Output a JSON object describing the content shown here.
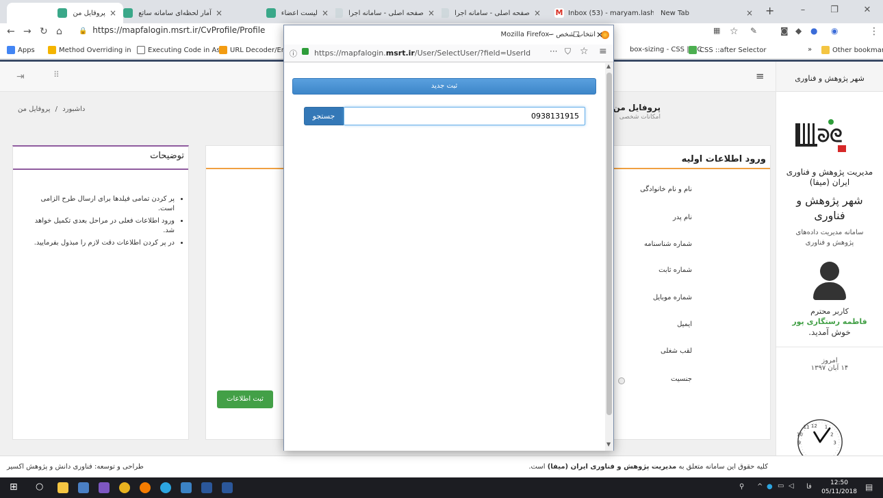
{
  "browser": {
    "tabs": [
      {
        "title": "پروفایل من",
        "active": true
      },
      {
        "title": "آمار لحظه‌ای سامانه ساتع"
      },
      {
        "title": "لیست اعضاء"
      },
      {
        "title": "صفحه اصلی - سامانه اجرا"
      },
      {
        "title": "صفحه اصلی - سامانه اجرا"
      },
      {
        "title": "Inbox (53) - maryam.lash"
      },
      {
        "title": "New Tab"
      }
    ],
    "url": "https://mapfalogin.msrt.ir/CvProfile/Profile",
    "bookmarks": [
      "Apps",
      "Method Overriding in",
      "Executing Code in As",
      "URL Decoder/Enc",
      "box-sizing - CSS | MC",
      "CSS ::after Selector",
      "»",
      "Other bookmarks"
    ]
  },
  "sidebar": {
    "header": "شهر پژوهش و فناوری",
    "org_name": "مدیریت پژوهش و فناوری ایران (میفا)",
    "city": "شهر پژوهش و فناوری",
    "system_desc": "سامانه مدیریت داده‌های پژوهش و فناوری",
    "greeting": "کاربر محترم",
    "user_name": "فاطمه رستگاری پور",
    "welcome": "خوش آمدید.",
    "today_label": "امروز",
    "today_date": "۱۴ آبان ۱۳۹۷"
  },
  "page": {
    "title": "پروفایل من",
    "subtitle": "امکانات شخصی",
    "breadcrumb_home": "داشبورد",
    "breadcrumb_sep": "/",
    "breadcrumb_current": "پروفایل من"
  },
  "form": {
    "title": "ورود اطلاعات اولیه",
    "fields": [
      "نام و نام خانوادگی",
      "نام پدر",
      "شماره شناسنامه",
      "شماره ثابت",
      "شماره موبایل",
      "ایمیل",
      "لقب شغلی",
      "جنسیت"
    ],
    "submit": "ثبت اطلاعات"
  },
  "notes": {
    "title": "توضیحات",
    "items": [
      "پر کردن تمامی فیلدها برای ارسال طرح الزامی است.",
      "ورود اطلاعات فعلی در مراحل بعدی تکمیل خواهد شد.",
      "در پر کردن اطلاعات دقت لازم را مبذول بفرمایید."
    ]
  },
  "footer": {
    "left": "طراحی و توسعه: فناوری دانش و پژوهش اکسیر",
    "right_pre": "کلیه حقوق این سامانه متعلق به",
    "right_bold": "مدیریت پژوهش و فناوری ایران (میفا)",
    "right_post": "است."
  },
  "popup": {
    "window_title": "انتخاب شخص - Mozilla Firefox",
    "url_pre": "https://mapfalogin.",
    "url_host": "msrt.ir",
    "url_post": "/User/SelectUser/?field=UserId",
    "new_button": "ثبت جدید",
    "search_button": "جستجو",
    "search_value": "0938131915"
  },
  "taskbar": {
    "time": "12:50",
    "date": "05/11/2018",
    "lang": "فا"
  },
  "colors": {
    "accent": "#3d86c9",
    "green": "#43a047",
    "purple": "#8e5a9e",
    "orange": "#f0a040"
  }
}
